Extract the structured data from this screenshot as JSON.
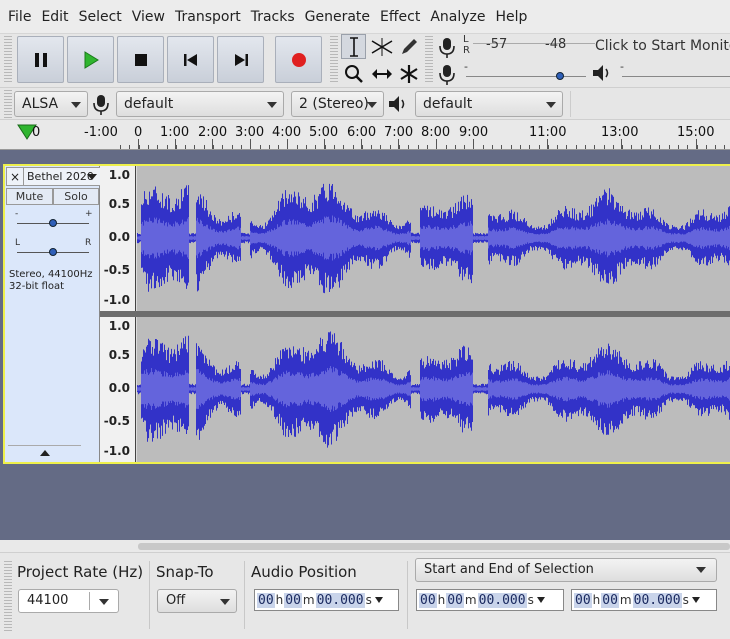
{
  "menu": [
    "File",
    "Edit",
    "Select",
    "View",
    "Transport",
    "Tracks",
    "Generate",
    "Effect",
    "Analyze",
    "Help"
  ],
  "transport": {
    "buttons": [
      "pause",
      "play",
      "stop",
      "skip-to-start",
      "skip-to-end",
      "record"
    ]
  },
  "meter": {
    "l": "L",
    "r": "R",
    "scale": [
      "-57",
      "-48"
    ],
    "monitor_text": "Click to Start Monitoring",
    "minus": "-",
    "playback_volume": 0.78
  },
  "device": {
    "host": "ALSA",
    "recording_device": "default",
    "channels": "2 (Stereo)",
    "playback_device": "default"
  },
  "ruler": {
    "labels": [
      "0",
      "-1:00",
      "0",
      "1:00",
      "2:00",
      "3:00",
      "4:00",
      "5:00",
      "6:00",
      "7:00",
      "8:00",
      "9:00",
      "11:00",
      "13:00",
      "15:00"
    ]
  },
  "track": {
    "close": "×",
    "name": "Bethel 2020",
    "mute": "Mute",
    "solo": "Solo",
    "gain_minus": "-",
    "gain_plus": "+",
    "pan_left": "L",
    "pan_right": "R",
    "info_line1": "Stereo, 44100Hz",
    "info_line2": "32-bit float",
    "vruler": [
      "1.0",
      "0.5",
      "0.0",
      "-0.5",
      "-1.0"
    ],
    "wave_color": "#3232c8",
    "rms_color": "#6464dc",
    "background": "#bcbcbc"
  },
  "selection": {
    "project_rate_label": "Project Rate (Hz)",
    "project_rate": "44100",
    "snap_label": "Snap-To",
    "snap_value": "Off",
    "audio_position_label": "Audio Position",
    "selection_mode": "Start and End of Selection",
    "time": {
      "h": "00",
      "h_unit": "h",
      "m": "00",
      "m_unit": "m",
      "s": "00.000",
      "s_unit": "s"
    }
  }
}
